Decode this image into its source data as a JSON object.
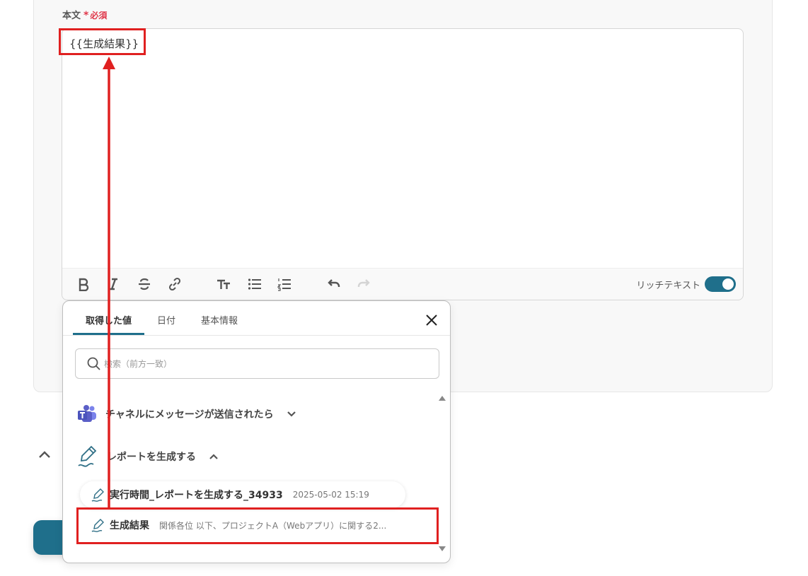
{
  "form": {
    "field_label": "本文",
    "required_star": "*",
    "required_text": "必須",
    "editor_value": "{{生成結果}}",
    "rich_text_label": "リッチテキスト",
    "rich_text_enabled": true
  },
  "toolbar": {
    "buttons": [
      "bold-icon",
      "italic-icon",
      "strikethrough-icon",
      "link-icon",
      "text-size-icon",
      "bullet-list-icon",
      "numbered-list-icon",
      "undo-icon",
      "redo-icon"
    ]
  },
  "popup": {
    "tabs": [
      {
        "label": "取得した値",
        "active": true
      },
      {
        "label": "日付",
        "active": false
      },
      {
        "label": "基本情報",
        "active": false
      }
    ],
    "search_placeholder": "検索（前方一致）",
    "sections": [
      {
        "title": "チャネルにメッセージが送信されたら",
        "icon": "teams-icon",
        "expanded": false
      },
      {
        "title": "レポートを生成する",
        "icon": "pen-icon",
        "expanded": true
      }
    ],
    "items": [
      {
        "title": "実行時間_レポートを生成する_34933",
        "value": "2025-05-02 15:19"
      },
      {
        "title": "生成結果",
        "value": "関係各位 以下、プロジェクトA（Webアプリ）に関する2..."
      }
    ]
  },
  "colors": {
    "accent": "#1f6f8b",
    "required": "#e0384b",
    "annotation": "#e02020"
  }
}
